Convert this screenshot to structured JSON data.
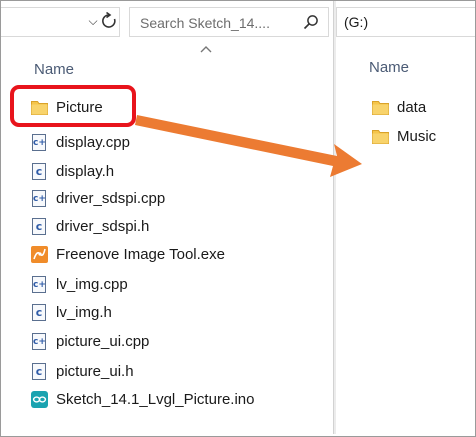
{
  "left_pane": {
    "search_placeholder": "Search Sketch_14....",
    "column_header": "Name",
    "files": [
      {
        "name": "Picture",
        "icon": "folder-icon"
      },
      {
        "name": "display.cpp",
        "icon": "cpp-file-icon"
      },
      {
        "name": "display.h",
        "icon": "c-header-file-icon"
      },
      {
        "name": "driver_sdspi.cpp",
        "icon": "cpp-file-icon"
      },
      {
        "name": "driver_sdspi.h",
        "icon": "c-header-file-icon"
      },
      {
        "name": "Freenove Image Tool.exe",
        "icon": "app-icon"
      },
      {
        "name": "lv_img.cpp",
        "icon": "cpp-file-icon"
      },
      {
        "name": "lv_img.h",
        "icon": "c-header-file-icon"
      },
      {
        "name": "picture_ui.cpp",
        "icon": "cpp-file-icon"
      },
      {
        "name": "picture_ui.h",
        "icon": "c-header-file-icon"
      },
      {
        "name": "Sketch_14.1_Lvgl_Picture.ino",
        "icon": "arduino-file-icon"
      }
    ]
  },
  "right_pane": {
    "address": "(G:)",
    "column_header": "Name",
    "files": [
      {
        "name": "data",
        "icon": "folder-icon"
      },
      {
        "name": "Music",
        "icon": "folder-icon"
      }
    ]
  },
  "colors": {
    "highlight": "#e8141c",
    "arrow": "#ec7b32",
    "folder": "#f5c54a",
    "header_text": "#4b5b75"
  }
}
